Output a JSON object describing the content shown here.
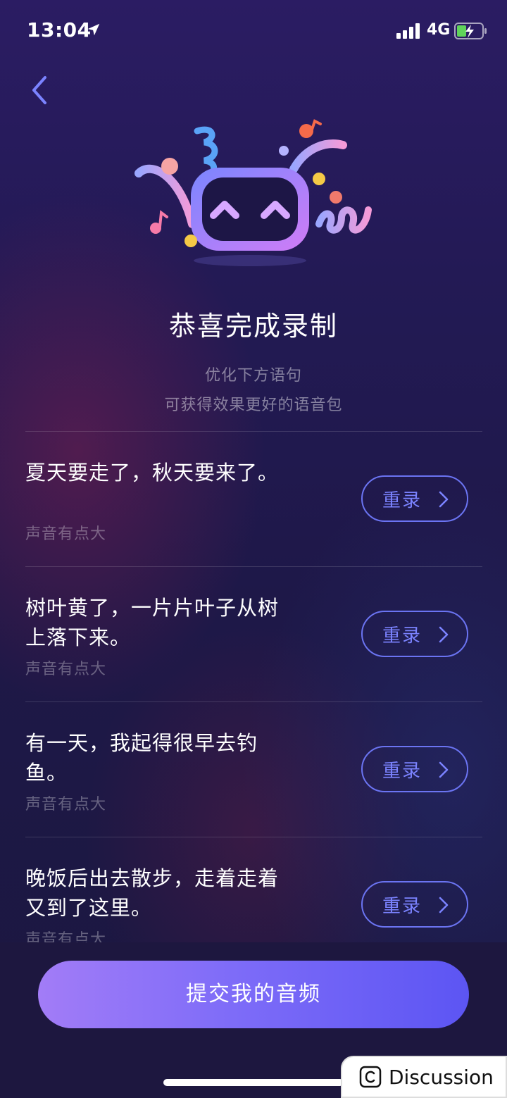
{
  "status": {
    "time": "13:04",
    "network": "4G"
  },
  "title": "恭喜完成录制",
  "subtitle": [
    "优化下方语句",
    "可获得效果更好的语音包"
  ],
  "items": [
    {
      "text": "夏天要走了，秋天要来了。",
      "hint": "声音有点大",
      "button": "重录"
    },
    {
      "text": "树叶黄了，一片片叶子从树上落下来。",
      "hint": "声音有点大",
      "button": "重录"
    },
    {
      "text": "有一天，我起得很早去钓鱼。",
      "hint": "声音有点大",
      "button": "重录"
    },
    {
      "text": "晚饭后出去散步，走着走着又到了这里。",
      "hint": "声音有点大",
      "button": "重录"
    }
  ],
  "submit_label": "提交我的音频",
  "watermark": "Discussion",
  "colors": {
    "accent": "#6b74f2",
    "submit_start": "#a27cf7",
    "submit_end": "#5c55f3"
  },
  "icons": [
    "location-arrow-icon",
    "signal-icon",
    "battery-charging-icon",
    "back-chevron-icon",
    "chevron-right-icon",
    "mascot-illustration",
    "copyright-icon"
  ]
}
